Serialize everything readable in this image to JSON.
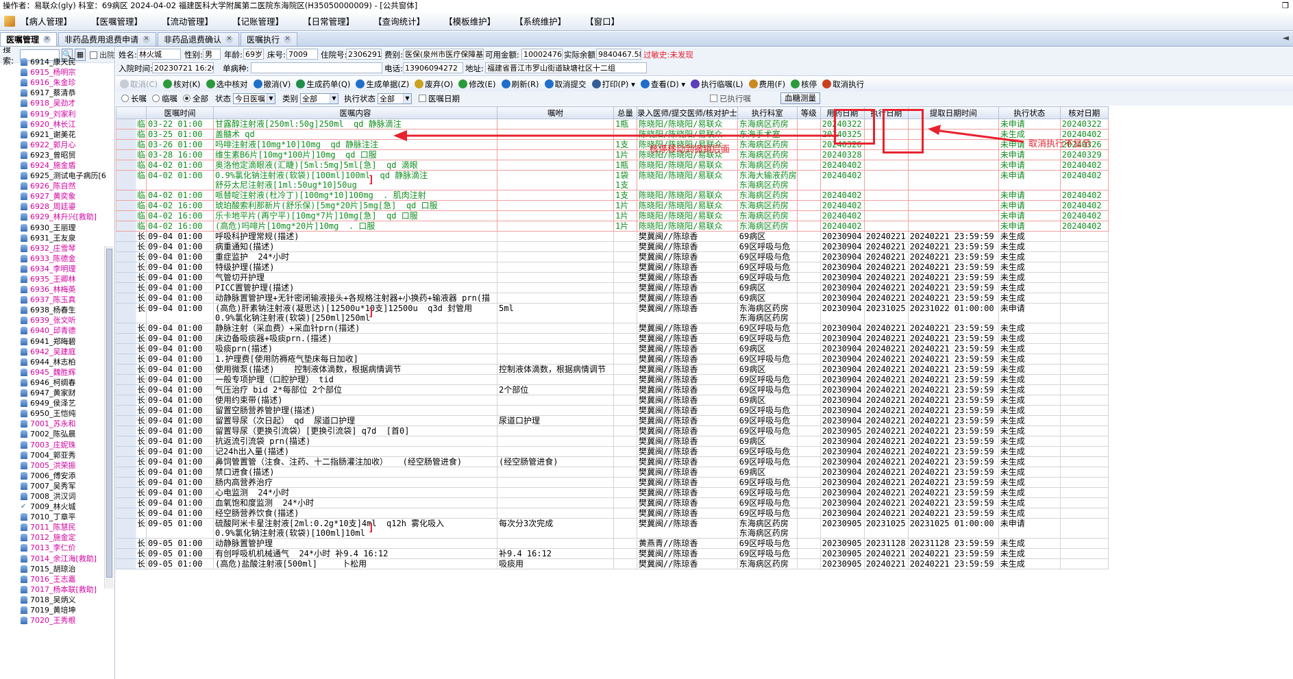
{
  "titlebar": {
    "text": "操作者：易联众(gly)  科室：69病区  2024-04-02  福建医科大学附属第二医院东海院区(H35050000009) - [公共窗体]",
    "restore": "❐"
  },
  "menu": [
    "【病人管理】",
    "【医嘱管理】",
    "【流动管理】",
    "【记账管理】",
    "【日常管理】",
    "【查询统计】",
    "【模板维护】",
    "【系统维护】",
    "【窗口】"
  ],
  "tabs": [
    {
      "label": "医嘱管理"
    },
    {
      "label": "非药品费用退费申请"
    },
    {
      "label": "非药品退费确认"
    },
    {
      "label": "医嘱执行"
    }
  ],
  "tab_arrow": "◄",
  "left": {
    "search_label": "搜索:",
    "search_value": "",
    "discharge_label": "出院",
    "patients": [
      {
        "n": "6914_康天民",
        "c": "n"
      },
      {
        "n": "6915_杨明宗",
        "c": "r"
      },
      {
        "n": "6916_朱金珍",
        "c": "r"
      },
      {
        "n": "6917_蔡清恭",
        "c": "n"
      },
      {
        "n": "6918_吴劲才",
        "c": "r"
      },
      {
        "n": "6919_刘家利",
        "c": "r"
      },
      {
        "n": "6920_林长江",
        "c": "r"
      },
      {
        "n": "6921_谢美花",
        "c": "n"
      },
      {
        "n": "6922_郭月心",
        "c": "r"
      },
      {
        "n": "6923_曾昭贸",
        "c": "n"
      },
      {
        "n": "6924_施金盾",
        "c": "r"
      },
      {
        "n": "6925_测试电子病历[6",
        "c": "n"
      },
      {
        "n": "6926_陈自然",
        "c": "r"
      },
      {
        "n": "6927_黄奕象",
        "c": "r"
      },
      {
        "n": "6928_周廷鎏",
        "c": "r"
      },
      {
        "n": "6929_林升兴[救助]",
        "c": "r"
      },
      {
        "n": "6930_王丽理",
        "c": "n"
      },
      {
        "n": "6931_王友泉",
        "c": "n"
      },
      {
        "n": "6932_庄雪琴",
        "c": "r"
      },
      {
        "n": "6933_陈德金",
        "c": "r"
      },
      {
        "n": "6934_李明理",
        "c": "r"
      },
      {
        "n": "6935_王卿林",
        "c": "r"
      },
      {
        "n": "6936_林梅英",
        "c": "r"
      },
      {
        "n": "6937_陈玉真",
        "c": "r"
      },
      {
        "n": "6938_杨春生",
        "c": "n"
      },
      {
        "n": "6939_张文听",
        "c": "r"
      },
      {
        "n": "6940_邱青德",
        "c": "r"
      },
      {
        "n": "6941_郑晦碧",
        "c": "n"
      },
      {
        "n": "6942_吴建庭",
        "c": "r"
      },
      {
        "n": "6944_林志柏",
        "c": "n"
      },
      {
        "n": "6945_魏胜辉",
        "c": "r"
      },
      {
        "n": "6946_柯绸春",
        "c": "n"
      },
      {
        "n": "6947_黄家财",
        "c": "n"
      },
      {
        "n": "6949_侯泽艺",
        "c": "n"
      },
      {
        "n": "6950_王恺纯",
        "c": "n"
      },
      {
        "n": "7001_苏永和",
        "c": "r"
      },
      {
        "n": "7002_陈弘晨",
        "c": "n"
      },
      {
        "n": "7003_庄妮珠",
        "c": "r"
      },
      {
        "n": "7004_郭亚秀",
        "c": "n"
      },
      {
        "n": "7005_洪荣振",
        "c": "r"
      },
      {
        "n": "7006_傅安添",
        "c": "n"
      },
      {
        "n": "7007_吴秀军",
        "c": "n"
      },
      {
        "n": "7008_洪汉词",
        "c": "n"
      },
      {
        "n": "7009_林火城",
        "c": "chk"
      },
      {
        "n": "7010_丁章平",
        "c": "n"
      },
      {
        "n": "7011_陈慧民",
        "c": "r"
      },
      {
        "n": "7012_施金定",
        "c": "r"
      },
      {
        "n": "7013_李仁价",
        "c": "r"
      },
      {
        "n": "7014_余江海[救助]",
        "c": "r"
      },
      {
        "n": "7015_胡琼治",
        "c": "n"
      },
      {
        "n": "7016_王志嘉",
        "c": "r"
      },
      {
        "n": "7017_杨本联[救助]",
        "c": "r"
      },
      {
        "n": "7018_吴炳义",
        "c": "n"
      },
      {
        "n": "7019_黄培坤",
        "c": "n"
      },
      {
        "n": "7020_王秀根",
        "c": "r"
      }
    ]
  },
  "info": {
    "name_l": "姓名:",
    "name": "林火城",
    "sex_l": "性别:",
    "sex": "男",
    "age_l": "年龄:",
    "age": "69岁",
    "bed_l": "床号:",
    "bed": "7009",
    "adm_l": "住院号:",
    "adm": "23062919",
    "fee_l": "费别:",
    "fee": "医保(泉州市医疗保障基金",
    "avail_l": "可用金额:",
    "avail": "10002476.07",
    "bal_l": "实际余额:",
    "bal": "9840467.58",
    "allergy": "过敏史:未发现",
    "time_l": "入院时间:",
    "time": "20230721 16:20:25",
    "dz_l": "单病种:",
    "dz": "",
    "tel_l": "电话:",
    "tel": "13906094272",
    "addr_l": "地址:",
    "addr": "福建省晋江市罗山街道缺塘社区十二组"
  },
  "toolbar": [
    {
      "l": "取消(C)",
      "d": true
    },
    {
      "l": "核对(K)"
    },
    {
      "l": "选中核对"
    },
    {
      "l": "撤消(V)"
    },
    {
      "l": "生成药单(Q)"
    },
    {
      "l": "生成单据(Z)"
    },
    {
      "l": "废弃(O)"
    },
    {
      "l": "修改(E)"
    },
    {
      "l": "刷新(R)"
    },
    {
      "l": "取消提交"
    },
    {
      "l": "打印(P) ▾"
    },
    {
      "l": "查看(D) ▾"
    },
    {
      "l": "执行临嘱(L)"
    },
    {
      "l": "费用(F)"
    },
    {
      "l": "核停"
    },
    {
      "l": "取消执行"
    }
  ],
  "filter": {
    "long": "长嘱",
    "temp": "临嘱",
    "all": "全部",
    "status_l": "状态",
    "status": "今日医嘱",
    "type_l": "类别",
    "type": "全部",
    "exec_l": "执行状态",
    "exec": "全部",
    "date_l": "医嘱日期",
    "prev_l": "已执行嘱",
    "bloodtest": "血糖测量"
  },
  "annotations": {
    "a1": "核停移动到撤销后面",
    "a2": "取消执行不显示"
  },
  "columns": [
    "",
    "医嘱时间",
    "医嘱内容",
    "嘱咐",
    "总量",
    "录入医师/提交医师/核对护士",
    "执行科室",
    "等级",
    "用药日期",
    "执行日期",
    "提取日期时间",
    "执行状态",
    "核对日期"
  ],
  "rows": [
    {
      "k": "临",
      "t": "03-22 01:00",
      "c": "甘露醇注射液[250ml:50g]250ml  qd 静脉滴注",
      "z": "",
      "q": "1瓶",
      "d": "陈晓阳/陈晓阳/易联众",
      "e": "东海病区药房",
      "u": "20240322",
      "x": "",
      "p": "",
      "s": "未申请",
      "h": "20240322",
      "lin": true
    },
    {
      "k": "临",
      "t": "03-25 01:00",
      "c": "盖髓术 qd",
      "z": "",
      "q": "",
      "d": "陈晓阳/陈晓阳/易联众",
      "e": "东海手术室",
      "u": "20240325",
      "x": "",
      "p": "",
      "s": "未生成",
      "h": "20240402",
      "lin": true
    },
    {
      "k": "临",
      "t": "03-26 01:00",
      "c": "吗啡注射液[10mg*10]10mg  qd 静脉注注",
      "z": "",
      "q": "1支",
      "d": "陈晓阳/陈晓阳/易联众",
      "e": "东海病区药房",
      "u": "20240326",
      "x": "",
      "p": "",
      "s": "未申请",
      "h": "20240326",
      "lin": true
    },
    {
      "k": "临",
      "t": "03-28 16:00",
      "c": "维生素B6片[10mg*100片]10mg  qd 口服",
      "z": "",
      "q": "1片",
      "d": "陈晓阳/陈晓阳/易联众",
      "e": "东海病区药房",
      "u": "20240328",
      "x": "",
      "p": "",
      "s": "未申请",
      "h": "20240329",
      "lin": true
    },
    {
      "k": "临",
      "t": "04-02 01:00",
      "c": "奥洛他定滴眼液(汇睫)[5ml:5mg]5ml[急]  qd 滴眼",
      "z": "",
      "q": "1瓶",
      "d": "陈晓阳/陈晓阳/易联众",
      "e": "东海病区药房",
      "u": "20240402",
      "x": "",
      "p": "",
      "s": "未申请",
      "h": "20240402",
      "lin": true
    },
    {
      "k": "临",
      "t": "04-02 01:00",
      "c": "0.9%氯化钠注射液(软袋)[100ml]100ml  qd 静脉滴注\n舒芬太尼注射液[1ml:50ug*10]50ug",
      "z": "",
      "q": "1袋\n1支",
      "d": "陈晓阳/陈晓阳/易联众",
      "e": "东海大输液药房\n东海病区药房",
      "u": "20240402",
      "x": "",
      "p": "",
      "s": "未申请",
      "h": "20240402",
      "lin": true,
      "br": true
    },
    {
      "k": "临",
      "t": "04-02 01:00",
      "c": "哌替啶注射液(杜冷丁)[100mg*10]100mg  . 肌肉注射",
      "z": "",
      "q": "1支",
      "d": "陈晓阳/陈晓阳/易联众",
      "e": "东海病区药房",
      "u": "20240402",
      "x": "",
      "p": "",
      "s": "未申请",
      "h": "20240402",
      "lin": true
    },
    {
      "k": "临",
      "t": "04-02 16:00",
      "c": "琥珀酸索利那新片(舒乐保)[5mg*20片]5mg[急]  qd 口服",
      "z": "",
      "q": "1片",
      "d": "陈晓阳/陈晓阳/易联众",
      "e": "东海病区药房",
      "u": "20240402",
      "x": "",
      "p": "",
      "s": "未申请",
      "h": "20240402",
      "lin": true
    },
    {
      "k": "临",
      "t": "04-02 16:00",
      "c": "乐卡地平片(再宁平)[10mg*7片]10mg[急]  qd 口服",
      "z": "",
      "q": "1片",
      "d": "陈晓阳/陈晓阳/易联众",
      "e": "东海病区药房",
      "u": "20240402",
      "x": "",
      "p": "",
      "s": "未申请",
      "h": "20240402",
      "lin": true
    },
    {
      "k": "临",
      "t": "04-02 16:00",
      "c": "(高危)吗啡片[10mg*20片]10mg  . 口服",
      "z": "",
      "q": "1片",
      "d": "陈晓阳/陈晓阳/易联众",
      "e": "东海病区药房",
      "u": "20240402",
      "x": "",
      "p": "",
      "s": "未申请",
      "h": "20240402",
      "lin": true
    },
    {
      "k": "长",
      "t": "09-04 01:00",
      "c": "呼吸科护理常规(描述)",
      "z": "",
      "q": "",
      "d": "樊冀闽//陈琼香",
      "e": "69病区",
      "u": "20230904",
      "x": "20240221",
      "p": "20240221  23:59:59",
      "s": "未生成",
      "h": ""
    },
    {
      "k": "长",
      "t": "09-04 01:00",
      "c": "病重通知(描述)",
      "z": "",
      "q": "",
      "d": "樊冀闽//陈琼香",
      "e": "69区呼吸与危",
      "u": "20230904",
      "x": "20240221",
      "p": "20240221  23:59:59",
      "s": "未生成",
      "h": ""
    },
    {
      "k": "长",
      "t": "09-04 01:00",
      "c": "重症监护  24*小时",
      "z": "",
      "q": "",
      "d": "樊冀闽//陈琼香",
      "e": "69区呼吸与危",
      "u": "20230904",
      "x": "20240221",
      "p": "20240221  23:59:59",
      "s": "未生成",
      "h": ""
    },
    {
      "k": "长",
      "t": "09-04 01:00",
      "c": "特级护理(描述)",
      "z": "",
      "q": "",
      "d": "樊冀闽//陈琼香",
      "e": "69区呼吸与危",
      "u": "20230904",
      "x": "20240221",
      "p": "20240221  23:59:59",
      "s": "未生成",
      "h": ""
    },
    {
      "k": "长",
      "t": "09-04 01:00",
      "c": "气管切开护理",
      "z": "",
      "q": "",
      "d": "樊冀闽//陈琼香",
      "e": "69区呼吸与危",
      "u": "20230904",
      "x": "20240221",
      "p": "20240221  23:59:59",
      "s": "未生成",
      "h": ""
    },
    {
      "k": "长",
      "t": "09-04 01:00",
      "c": "PICC置管护理(描述)",
      "z": "",
      "q": "",
      "d": "樊冀闽//陈琼香",
      "e": "69病区",
      "u": "20230904",
      "x": "20240221",
      "p": "20240221  23:59:59",
      "s": "未生成",
      "h": ""
    },
    {
      "k": "长",
      "t": "09-04 01:00",
      "c": "动静脉置管护理+无针密闭输液接头+各规格注射器+小换药+输液器 prn(描",
      "z": "",
      "q": "",
      "d": "樊冀闽//陈琼香",
      "e": "69病区",
      "u": "20230904",
      "x": "20240221",
      "p": "20240221  23:59:59",
      "s": "未生成",
      "h": ""
    },
    {
      "k": "长",
      "t": "09-04 01:00",
      "c": "(高危)肝素钠注射液(凝思达)[12500u*10支]12500u  q3d 封管用\n0.9%氯化钠注射液(软袋)[250ml]250ml",
      "z": "5ml",
      "q": "",
      "d": "樊冀闽//陈琼香",
      "e": "东海病区药房\n东海病区药房",
      "u": "20230904",
      "x": "20231025",
      "p": "20231022  01:00:00",
      "s": "未申请",
      "h": "",
      "br": true
    },
    {
      "k": "长",
      "t": "09-04 01:00",
      "c": "静脉注射（采血费）+采血针prn(描述)",
      "z": "",
      "q": "",
      "d": "樊冀闽//陈琼香",
      "e": "69区呼吸与危",
      "u": "20230904",
      "x": "20240221",
      "p": "20240221  23:59:59",
      "s": "未生成",
      "h": ""
    },
    {
      "k": "长",
      "t": "09-04 01:00",
      "c": "床边备吸痰器+吸痰prn.(描述)",
      "z": "",
      "q": "",
      "d": "樊冀闽//陈琼香",
      "e": "69区呼吸与危",
      "u": "20230904",
      "x": "20240221",
      "p": "20240221  23:59:59",
      "s": "未生成",
      "h": ""
    },
    {
      "k": "长",
      "t": "09-04 01:00",
      "c": "吸痰prn(描述)",
      "z": "",
      "q": "",
      "d": "樊冀闽//陈琼香",
      "e": "69病区",
      "u": "20230904",
      "x": "20240221",
      "p": "20240221  23:59:59",
      "s": "未生成",
      "h": ""
    },
    {
      "k": "长",
      "t": "09-04 01:00",
      "c": "1.护理费[使用防褥疮气垫床每日加收]",
      "z": "",
      "q": "",
      "d": "樊冀闽//陈琼香",
      "e": "69区呼吸与危",
      "u": "20230904",
      "x": "20240221",
      "p": "20240221  23:59:59",
      "s": "未生成",
      "h": ""
    },
    {
      "k": "长",
      "t": "09-04 01:00",
      "c": "使用微泵(描述)    控制液体滴数，根据病情调节",
      "z": "控制液体滴数，根据病情调节",
      "q": "",
      "d": "樊冀闽//陈琼香",
      "e": "69病区",
      "u": "20230904",
      "x": "20240221",
      "p": "20240221  23:59:59",
      "s": "未生成",
      "h": ""
    },
    {
      "k": "长",
      "t": "09-04 01:00",
      "c": "一般专项护理（口腔护理） tid",
      "z": "",
      "q": "",
      "d": "樊冀闽//陈琼香",
      "e": "69区呼吸与危",
      "u": "20230904",
      "x": "20240221",
      "p": "20240221  23:59:59",
      "s": "未生成",
      "h": ""
    },
    {
      "k": "长",
      "t": "09-04 01:00",
      "c": "气压治疗 bid 2*每部位 2个部位",
      "z": "2个部位",
      "q": "",
      "d": "樊冀闽//陈琼香",
      "e": "69区呼吸与危",
      "u": "20230904",
      "x": "20240221",
      "p": "20240221  23:59:59",
      "s": "未生成",
      "h": ""
    },
    {
      "k": "长",
      "t": "09-04 01:00",
      "c": "使用约束带(描述)",
      "z": "",
      "q": "",
      "d": "樊冀闽//陈琼香",
      "e": "69病区",
      "u": "20230904",
      "x": "20240221",
      "p": "20240221  23:59:59",
      "s": "未生成",
      "h": ""
    },
    {
      "k": "长",
      "t": "09-04 01:00",
      "c": "留置空肠营养管护理(描述)",
      "z": "",
      "q": "",
      "d": "樊冀闽//陈琼香",
      "e": "69区呼吸与危",
      "u": "20230904",
      "x": "20240221",
      "p": "20240221  23:59:59",
      "s": "未生成",
      "h": ""
    },
    {
      "k": "长",
      "t": "09-04 01:00",
      "c": "留置导尿（次日起） qd  尿道口护理",
      "z": "尿道口护理",
      "q": "",
      "d": "樊冀闽//陈琼香",
      "e": "69区呼吸与危",
      "u": "20230904",
      "x": "20240221",
      "p": "20240221  23:59:59",
      "s": "未生成",
      "h": ""
    },
    {
      "k": "长",
      "t": "09-04 01:00",
      "c": "留置导尿（更换引流袋）[更换引流袋] q7d  [首0]",
      "z": "",
      "q": "",
      "d": "樊冀闽//陈琼香",
      "e": "69区呼吸与危",
      "u": "20230905",
      "x": "20240221",
      "p": "20240221  23:59:59",
      "s": "未生成",
      "h": ""
    },
    {
      "k": "长",
      "t": "09-04 01:00",
      "c": "抗返流引流袋 prn(描述)",
      "z": "",
      "q": "",
      "d": "樊冀闽//陈琼香",
      "e": "69病区",
      "u": "20230904",
      "x": "20240221",
      "p": "20240221  23:59:59",
      "s": "未生成",
      "h": ""
    },
    {
      "k": "长",
      "t": "09-04 01:00",
      "c": "记24h出入量(描述)",
      "z": "",
      "q": "",
      "d": "樊冀闽//陈琼香",
      "e": "69区呼吸与危",
      "u": "20230904",
      "x": "20240221",
      "p": "20240221  23:59:59",
      "s": "未生成",
      "h": ""
    },
    {
      "k": "长",
      "t": "09-04 01:00",
      "c": "鼻饲管置管（注食、注药、十二指肠灌注加收）   (经空肠管进食)",
      "z": "(经空肠管进食)",
      "q": "",
      "d": "樊冀闽//陈琼香",
      "e": "69区呼吸与危",
      "u": "20230904",
      "x": "20240221",
      "p": "20240221  23:59:59",
      "s": "未生成",
      "h": ""
    },
    {
      "k": "长",
      "t": "09-04 01:00",
      "c": "禁口进食(描述)",
      "z": "",
      "q": "",
      "d": "樊冀闽//陈琼香",
      "e": "69病区",
      "u": "20230904",
      "x": "20240221",
      "p": "20240221  23:59:59",
      "s": "未生成",
      "h": ""
    },
    {
      "k": "长",
      "t": "09-04 01:00",
      "c": "肠内高营养治疗",
      "z": "",
      "q": "",
      "d": "樊冀闽//陈琼香",
      "e": "69区呼吸与危",
      "u": "20230904",
      "x": "20240221",
      "p": "20240221  23:59:59",
      "s": "未生成",
      "h": ""
    },
    {
      "k": "长",
      "t": "09-04 01:00",
      "c": "心电监测  24*小时",
      "z": "",
      "q": "",
      "d": "樊冀闽//陈琼香",
      "e": "69区呼吸与危",
      "u": "20230904",
      "x": "20240221",
      "p": "20240221  23:59:59",
      "s": "未生成",
      "h": ""
    },
    {
      "k": "长",
      "t": "09-04 01:00",
      "c": "血氧饱和度监测  24*小时",
      "z": "",
      "q": "",
      "d": "樊冀闽//陈琼香",
      "e": "69区呼吸与危",
      "u": "20230904",
      "x": "20240221",
      "p": "20240221  23:59:59",
      "s": "未生成",
      "h": ""
    },
    {
      "k": "长",
      "t": "09-04 01:00",
      "c": "经空肠营养饮食(描述)",
      "z": "",
      "q": "",
      "d": "樊冀闽//陈琼香",
      "e": "69区呼吸与危",
      "u": "20230904",
      "x": "20240221",
      "p": "20240221  23:59:59",
      "s": "未生成",
      "h": ""
    },
    {
      "k": "长",
      "t": "09-05 01:00",
      "c": "硫酸阿米卡星注射液[2ml:0.2g*10支]4ml  q12h 雾化吸入\n0.9%氯化钠注射液(软袋)[100ml]10ml",
      "z": "每次分3次完成",
      "q": "",
      "d": "樊冀闽//陈琼香",
      "e": "东海病区药房\n东海病区药房",
      "u": "20230905",
      "x": "20231025",
      "p": "20231025  01:00:00",
      "s": "未申请",
      "h": "",
      "br": true
    },
    {
      "k": "长",
      "t": "09-05 01:00",
      "c": "动静脉置管护理",
      "z": "",
      "q": "",
      "d": "黄燕青//陈琼香",
      "e": "69区呼吸与危",
      "u": "20230905",
      "x": "20231128",
      "p": "20231128  23:59:59",
      "s": "未生成",
      "h": ""
    },
    {
      "k": "长",
      "t": "09-05 01:00",
      "c": "有创呼吸机机械通气  24*小时 补9.4 16:12",
      "z": "补9.4 16:12",
      "q": "",
      "d": "樊冀闽//陈琼香",
      "e": "69区呼吸与危",
      "u": "20230905",
      "x": "20240221",
      "p": "20240221  23:59:59",
      "s": "未生成",
      "h": ""
    },
    {
      "k": "长",
      "t": "09-05 01:00",
      "c": "(高危)盐酸注射液[500ml]     卜松用",
      "z": "吸痰用",
      "q": "",
      "d": "樊冀闽//陈琼香",
      "e": "东海病区药房",
      "u": "20230905",
      "x": "20240221",
      "p": "20240221  23:59:59",
      "s": "未生成",
      "h": ""
    }
  ]
}
